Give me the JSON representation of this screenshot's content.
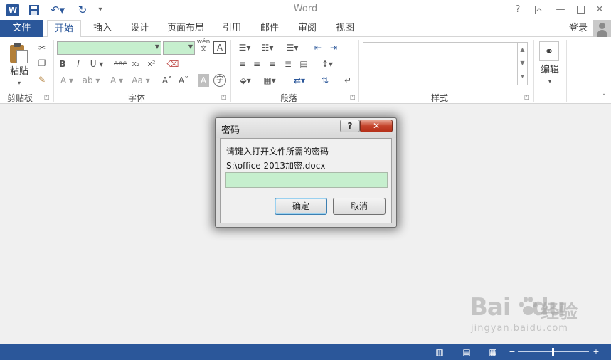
{
  "window": {
    "app_icon": "W",
    "title": "Word",
    "qat": {
      "save_icon": "save-icon",
      "undo_icon": "undo-icon",
      "redo_icon": "redo-icon",
      "customize_icon": "customize-qat-icon"
    },
    "controls": {
      "help": "?",
      "ribbon_display": "ribbon-display-icon",
      "minimize": "minimize-icon",
      "maximize": "maximize-icon",
      "close": "close-icon"
    }
  },
  "tabs": {
    "file": "文件",
    "items": [
      "开始",
      "插入",
      "设计",
      "页面布局",
      "引用",
      "邮件",
      "审阅",
      "视图"
    ],
    "active": "开始",
    "login": "登录"
  },
  "ribbon": {
    "clipboard": {
      "label": "剪贴板",
      "paste": "粘贴"
    },
    "font": {
      "label": "字体",
      "wen": "wén",
      "wen_char": "文",
      "strike": "abc",
      "aa": "Aa"
    },
    "paragraph": {
      "label": "段落"
    },
    "styles": {
      "label": "样式"
    },
    "editing": {
      "label": "编辑"
    }
  },
  "dialog": {
    "title": "密码",
    "help": "?",
    "close": "✕",
    "prompt": "请键入打开文件所需的密码",
    "filename": "S:\\office 2013加密.docx",
    "password_value": "",
    "ok": "确定",
    "cancel": "取消"
  },
  "watermark": {
    "brand": "Bai",
    "brand2": "du",
    "cn": "经验",
    "url": "jingyan.baidu.com"
  },
  "colors": {
    "accent": "#2b579a",
    "field_highlight": "#c6efce",
    "close_red": "#c4432b"
  }
}
